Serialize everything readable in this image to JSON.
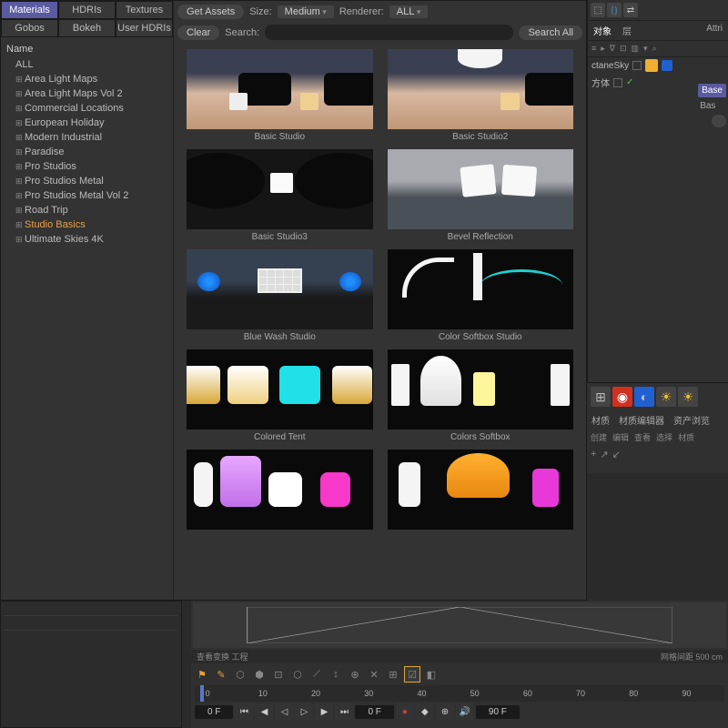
{
  "tabs": {
    "materials": "Materials",
    "hdris": "HDRIs",
    "textures": "Textures",
    "gobos": "Gobos",
    "bokeh": "Bokeh",
    "user_hdris": "User HDRIs"
  },
  "tree": {
    "header": "Name",
    "items": [
      {
        "label": "ALL",
        "expand": false
      },
      {
        "label": "Area Light Maps"
      },
      {
        "label": "Area Light Maps Vol 2"
      },
      {
        "label": "Commercial Locations"
      },
      {
        "label": "European Holiday"
      },
      {
        "label": "Modern Industrial"
      },
      {
        "label": "Paradise"
      },
      {
        "label": "Pro Studios"
      },
      {
        "label": "Pro Studios Metal"
      },
      {
        "label": "Pro Studios Metal Vol 2"
      },
      {
        "label": "Road Trip"
      },
      {
        "label": "Studio Basics",
        "selected": true
      },
      {
        "label": "Ultimate Skies 4K"
      }
    ]
  },
  "toolbar": {
    "get_assets": "Get Assets",
    "size": "Size:",
    "size_val": "Medium",
    "renderer": "Renderer:",
    "renderer_val": "ALL",
    "clear": "Clear",
    "search": "Search:",
    "search_all": "Search All"
  },
  "thumbs": [
    "Basic Studio",
    "Basic Studio2",
    "Basic Studio3",
    "Bevel Reflection",
    "Blue Wash Studio",
    "Color Softbox Studio",
    "Colored Tent",
    "Colors Softbox",
    "",
    ""
  ],
  "right": {
    "tab_obj": "对象",
    "tab_layer": "层",
    "attrib": "Attri",
    "row1": "ctaneSky",
    "row2": "方体",
    "base": "Base",
    "bas": "Bas",
    "icons_tb": [
      "≡",
      "▸",
      "ᐁ",
      "⊡",
      "▥",
      "▾",
      "⌕"
    ]
  },
  "mat": {
    "tab1": "材质",
    "tab2": "材质编辑器",
    "tab3": "资产浏览",
    "sub": [
      "创建",
      "编辑",
      "查看",
      "选择",
      "材质"
    ],
    "plus": "+"
  },
  "timeline": {
    "status_l": "查看变换  工程",
    "status_r_lbl": "网格间距",
    "status_r_val": "500 cm",
    "ruler": [
      "0",
      "10",
      "20",
      "30",
      "40",
      "50",
      "60",
      "70",
      "80",
      "90"
    ],
    "frame_l": "0 F",
    "frame_cur": "0 F",
    "frame_r": "90 F"
  }
}
